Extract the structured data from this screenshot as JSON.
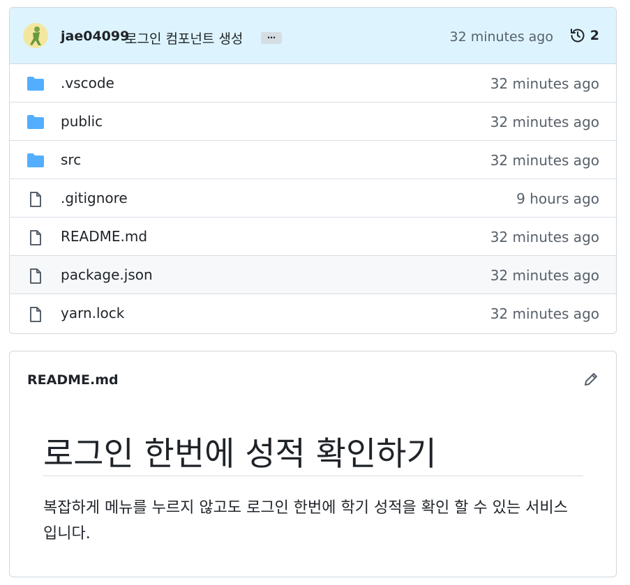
{
  "commit": {
    "author": "jae04099",
    "message": "로그인 컴포넌트 생성",
    "ellipsis": "…",
    "time": "32 minutes ago",
    "history_count": "2",
    "history_icon": "history-icon"
  },
  "files": [
    {
      "name": ".vscode",
      "type": "folder",
      "time": "32 minutes ago"
    },
    {
      "name": "public",
      "type": "folder",
      "time": "32 minutes ago"
    },
    {
      "name": "src",
      "type": "folder",
      "time": "32 minutes ago"
    },
    {
      "name": ".gitignore",
      "type": "file",
      "time": "9 hours ago"
    },
    {
      "name": "README.md",
      "type": "file",
      "time": "32 minutes ago"
    },
    {
      "name": "package.json",
      "type": "file",
      "time": "32 minutes ago"
    },
    {
      "name": "yarn.lock",
      "type": "file",
      "time": "32 minutes ago"
    }
  ],
  "readme": {
    "filename": "README.md",
    "heading": "로그인 한번에 성적 확인하기",
    "paragraph": "복잡하게 메뉴를 누르지 않고도 로그인 한번에 학기 성적을 확인 할 수 있는 서비스 입니다."
  },
  "colors": {
    "commit_bar_bg": "#ddf4ff",
    "folder_icon": "#54aeff",
    "file_icon": "#57606a",
    "border": "#d0d7de"
  }
}
